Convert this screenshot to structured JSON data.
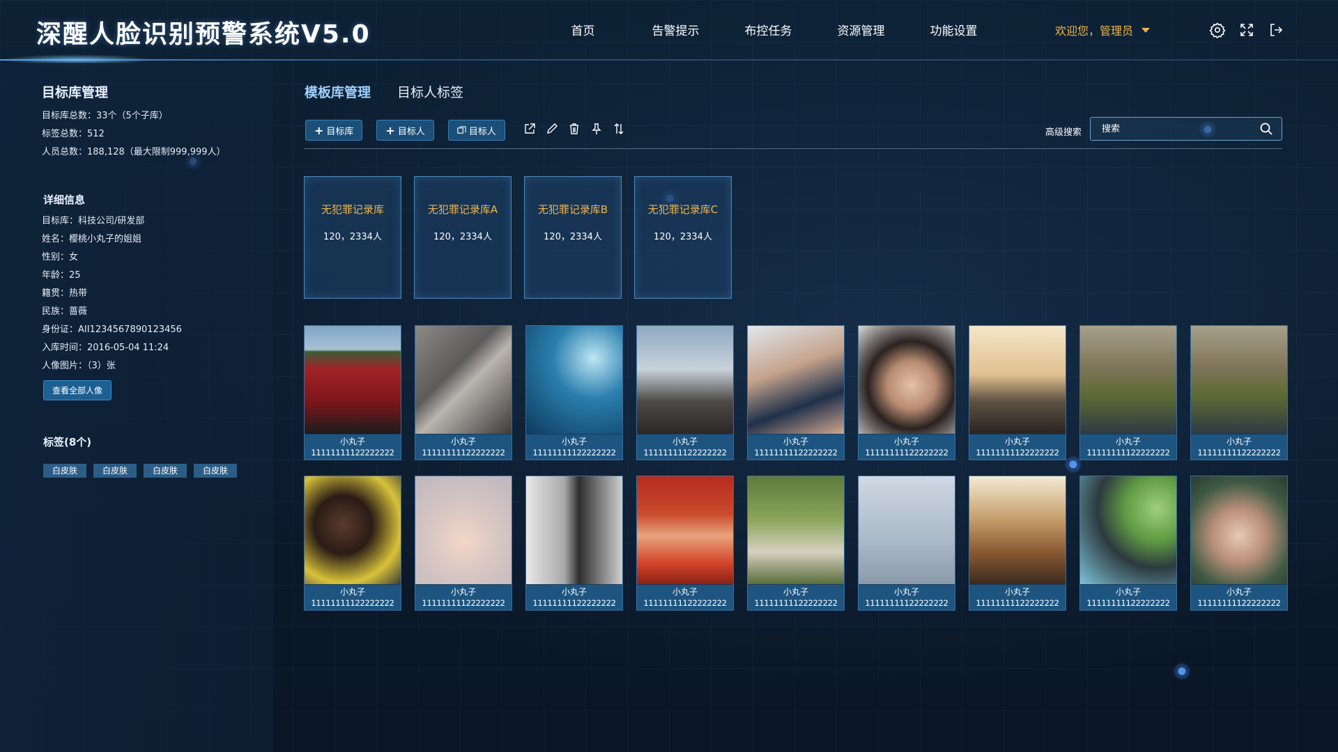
{
  "header": {
    "title": "深醒人脸识别预警系统V5.0",
    "nav": [
      "首页",
      "告警提示",
      "布控任务",
      "资源管理",
      "功能设置"
    ],
    "user": "欢迎您，管理员",
    "icons": [
      "gear-icon",
      "fullscreen-icon",
      "logout-icon"
    ]
  },
  "left": {
    "lib_title": "目标库管理",
    "stats": [
      "目标库总数：33个（5个子库）",
      "标签总数：512",
      "人员总数：188,128（最大限制999,999人）"
    ],
    "detail_title": "详细信息",
    "details": [
      "目标库：科技公司/研发部",
      "姓名：樱桃小丸子的姐姐",
      "性别：女",
      "年龄：25",
      "籍贯：热带",
      "民族：蔷薇",
      "身份证：AII1234567890123456",
      "入库时间：2016-05-04 11:24",
      "人像图片：（3）张"
    ],
    "view_all_button": "查看全部人像",
    "tags_title": "标签(8个)",
    "tags": [
      "白皮肤",
      "白皮肤",
      "白皮肤",
      "白皮肤"
    ]
  },
  "main": {
    "tabs": [
      "模板库管理",
      "目标人标签"
    ],
    "toolbar": {
      "add_lib": "目标库",
      "add_person": "目标人",
      "copy_person": "目标人",
      "icons": [
        "export-icon",
        "edit-icon",
        "trash-icon",
        "pin-icon",
        "sort-icon"
      ]
    },
    "advanced_search": "高级搜索",
    "search_placeholder": "搜索",
    "libraries": [
      {
        "name": "无犯罪记录库",
        "count": "120，2334人"
      },
      {
        "name": "无犯罪记录库A",
        "count": "120，2334人"
      },
      {
        "name": "无犯罪记录库B",
        "count": "120，2334人"
      },
      {
        "name": "无犯罪记录库C",
        "count": "120，2334人"
      }
    ],
    "cards": [
      {
        "name": "小丸子",
        "id": "11111111122222222",
        "photo": "red-car"
      },
      {
        "name": "小丸子",
        "id": "11111111122222222",
        "photo": "boy-stone"
      },
      {
        "name": "小丸子",
        "id": "11111111122222222",
        "photo": "aquarium"
      },
      {
        "name": "小丸子",
        "id": "11111111122222222",
        "photo": "child-house"
      },
      {
        "name": "小丸子",
        "id": "11111111122222222",
        "photo": "baby-shoe"
      },
      {
        "name": "小丸子",
        "id": "11111111122222222",
        "photo": "girl-face"
      },
      {
        "name": "小丸子",
        "id": "11111111122222222",
        "photo": "sunset-beach"
      },
      {
        "name": "小丸子",
        "id": "11111111122222222",
        "photo": "girl-field"
      },
      {
        "name": "小丸子",
        "id": "11111111122222222",
        "photo": "girl-field-2"
      },
      {
        "name": "小丸子",
        "id": "11111111122222222",
        "photo": "girl-flowers"
      },
      {
        "name": "小丸子",
        "id": "11111111122222222",
        "photo": "confetti"
      },
      {
        "name": "小丸子",
        "id": "11111111122222222",
        "photo": "bw-street"
      },
      {
        "name": "小丸子",
        "id": "11111111122222222",
        "photo": "boy-chocolate"
      },
      {
        "name": "小丸子",
        "id": "11111111122222222",
        "photo": "kids-fence"
      },
      {
        "name": "小丸子",
        "id": "11111111122222222",
        "photo": "swing"
      },
      {
        "name": "小丸子",
        "id": "11111111122222222",
        "photo": "man-window"
      },
      {
        "name": "小丸子",
        "id": "11111111122222222",
        "photo": "girl-balloon"
      },
      {
        "name": "小丸子",
        "id": "11111111122222222",
        "photo": "mother-child"
      }
    ]
  },
  "colors": {
    "accent_gold": "#f1b54b",
    "button_blue": "#1b4f78",
    "caption_blue": "#1d5580"
  }
}
